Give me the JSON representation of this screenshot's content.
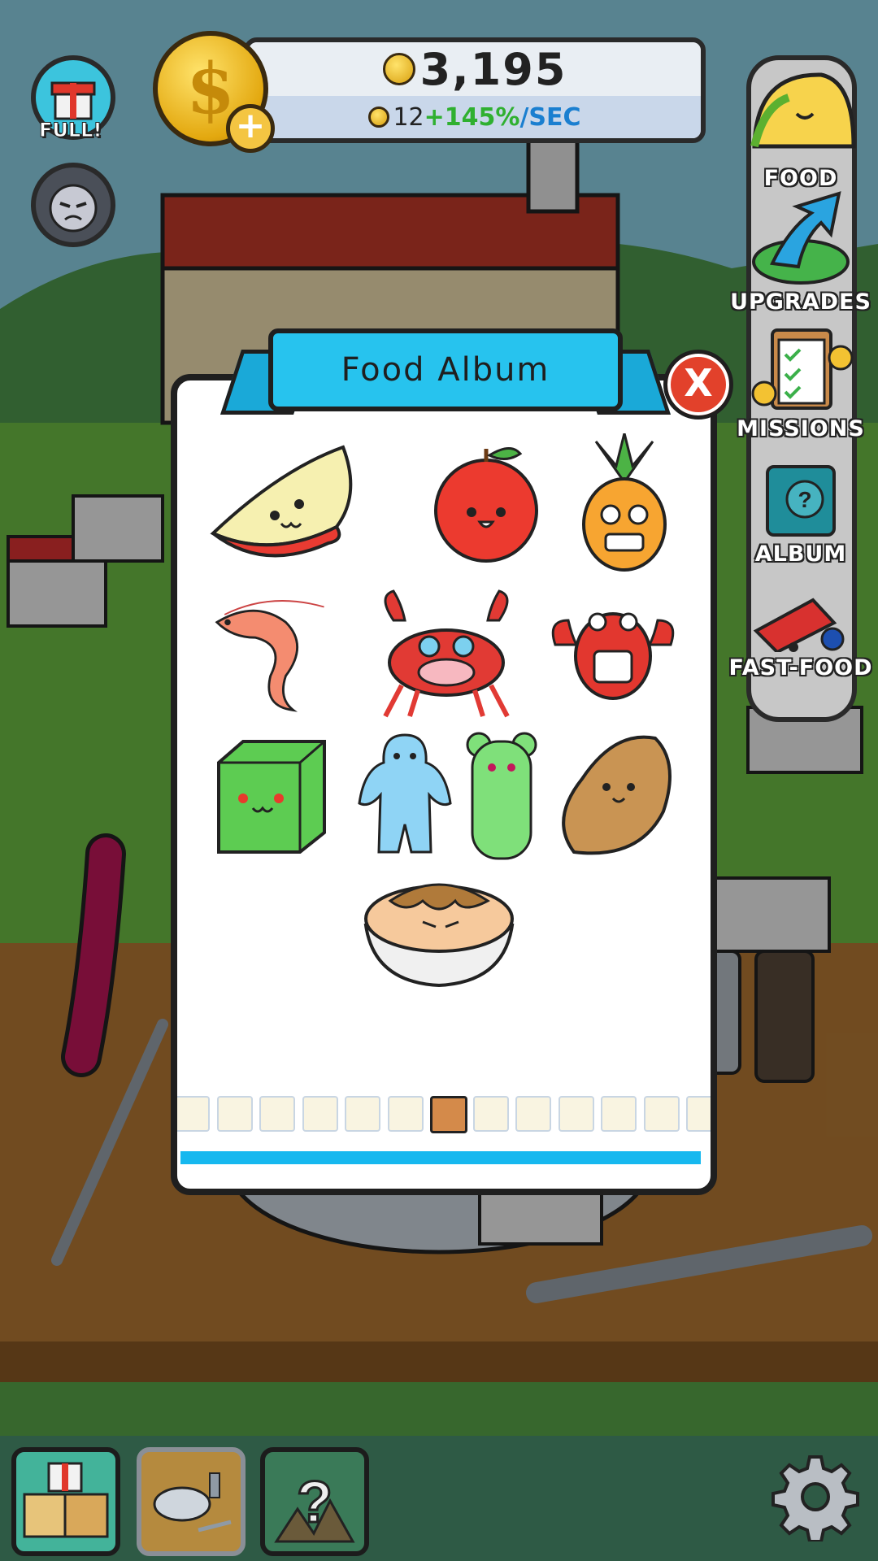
{
  "header": {
    "coins": "3,195",
    "rate_base": "12",
    "rate_bonus": "+145%",
    "rate_unit": "/SEC"
  },
  "left_buttons": {
    "gift_label": "FULL!"
  },
  "side_menu": {
    "items": [
      {
        "label": "FOOD",
        "icon": "taco-icon"
      },
      {
        "label": "UPGRADES",
        "icon": "arrow-up-icon"
      },
      {
        "label": "MISSIONS",
        "icon": "clipboard-icon"
      },
      {
        "label": "ALBUM",
        "icon": "book-icon"
      },
      {
        "label": "FAST-FOOD",
        "icon": "truck-icon"
      }
    ]
  },
  "modal": {
    "title": "Food Album",
    "close_label": "X",
    "foods": [
      "apple-slice",
      "apple",
      "pineapple",
      "shrimp",
      "crab",
      "lobster",
      "green-jelly-cube",
      "blue-gummy",
      "green-gummy-bear",
      "potato",
      "pie"
    ],
    "page_count": 13,
    "active_page": 7
  },
  "bottom_bar": {
    "buttons": [
      "gift-crates-icon",
      "table-icon",
      "mystery-icon"
    ],
    "settings": "gear-icon"
  },
  "colors": {
    "accent": "#27c3ee",
    "close": "#e2412b",
    "bonus": "#2fb030",
    "unit": "#1a7fd0"
  }
}
